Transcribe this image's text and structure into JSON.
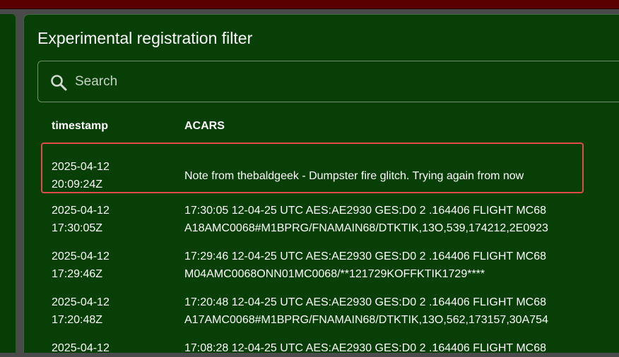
{
  "panel": {
    "title": "Experimental registration filter",
    "search": {
      "placeholder": "Search",
      "value": ""
    },
    "table": {
      "headers": {
        "timestamp": "timestamp",
        "acars": "ACARS"
      },
      "rows": [
        {
          "timestamp": "2025-04-12\n20:09:24Z",
          "acars": "Note from thebaldgeek - Dumpster fire glitch. Trying again from now",
          "highlighted": true
        },
        {
          "timestamp": "2025-04-12\n17:30:05Z",
          "acars": "17:30:05 12-04-25 UTC AES:AE2930 GES:D0 2 .164406 FLIGHT MC68\nA18AMC0068#M1BPRG/FNAMAIN68/DTKTIK,13O,539,174212,2E0923"
        },
        {
          "timestamp": "2025-04-12\n17:29:46Z",
          "acars": "17:29:46 12-04-25 UTC AES:AE2930 GES:D0 2 .164406 FLIGHT MC68\nM04AMC0068ONN01MC0068/**121729KOFFKTIK1729****"
        },
        {
          "timestamp": "2025-04-12\n17:20:48Z",
          "acars": "17:20:48 12-04-25 UTC AES:AE2930 GES:D0 2 .164406 FLIGHT MC68\nA17AMC0068#M1BPRG/FNAMAIN68/DTKTIK,13O,562,173157,30A754"
        },
        {
          "timestamp": "2025-04-12",
          "acars": "17:08:28 12-04-25 UTC AES:AE2930 GES:D0 2 .164406 FLIGHT MC68"
        }
      ]
    }
  },
  "colors": {
    "background": "#083f06",
    "topbar": "#5a0000",
    "highlight_border": "#e14b4b",
    "text": "#ffffff"
  },
  "icons": {
    "search": "search-icon"
  }
}
